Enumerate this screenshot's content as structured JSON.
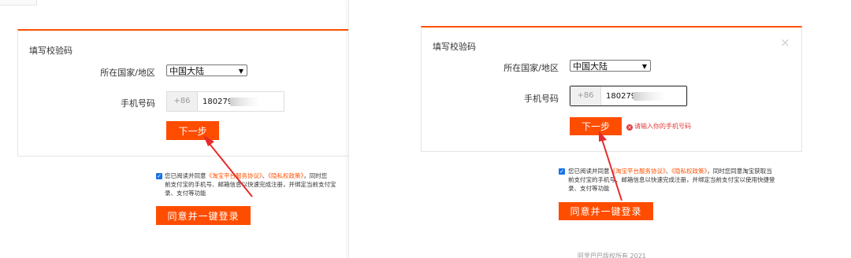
{
  "left": {
    "title": "填写校验码",
    "region_label": "所在国家/地区",
    "region_value": "中国大陆",
    "phone_label": "手机号码",
    "prefix": "+86",
    "phone_value": "180279",
    "next_button": "下一步",
    "agree_line1_a": "您已阅读并同意",
    "agree_link1": "《淘宝平台服务协议》",
    "agree_sep": "、",
    "agree_link2": "《隐私权政策》",
    "agree_line1_b": "，同时您",
    "agree_line2": "前支付宝的手机号、邮箱信息以快速完成注册，并绑定当前支付宝",
    "agree_line3": "录、支付等功能",
    "login_button": "同意并一键登录"
  },
  "right": {
    "title": "填写校验码",
    "close_icon": "×",
    "region_label": "所在国家/地区",
    "region_value": "中国大陆",
    "phone_label": "手机号码",
    "prefix": "+86",
    "phone_value": "180279",
    "next_button": "下一步",
    "error_text": "请输入你的手机号码",
    "agree_line1_a": "您已阅读并同意",
    "agree_link1": "《淘宝平台服务协议》",
    "agree_sep": "、",
    "agree_link2": "《隐私权政策》",
    "agree_line1_b": "，同时您同意淘宝获取当",
    "agree_line2": "前支付宝的手机号、邮箱信息以快速完成注册，并绑定当前支付宝以使用快捷登",
    "agree_line3": "录、支付等功能",
    "login_button": "同意并一键登录",
    "footer": "阿里巴巴版权所有 2021"
  },
  "colors": {
    "accent": "#ff4d00",
    "error": "#e4393c",
    "link": "#ff5000"
  },
  "icons": {
    "dropdown": "chevron-down-icon",
    "checkbox": "checkbox-checked-icon",
    "error": "error-circle-icon",
    "annotation": "red-arrow"
  }
}
